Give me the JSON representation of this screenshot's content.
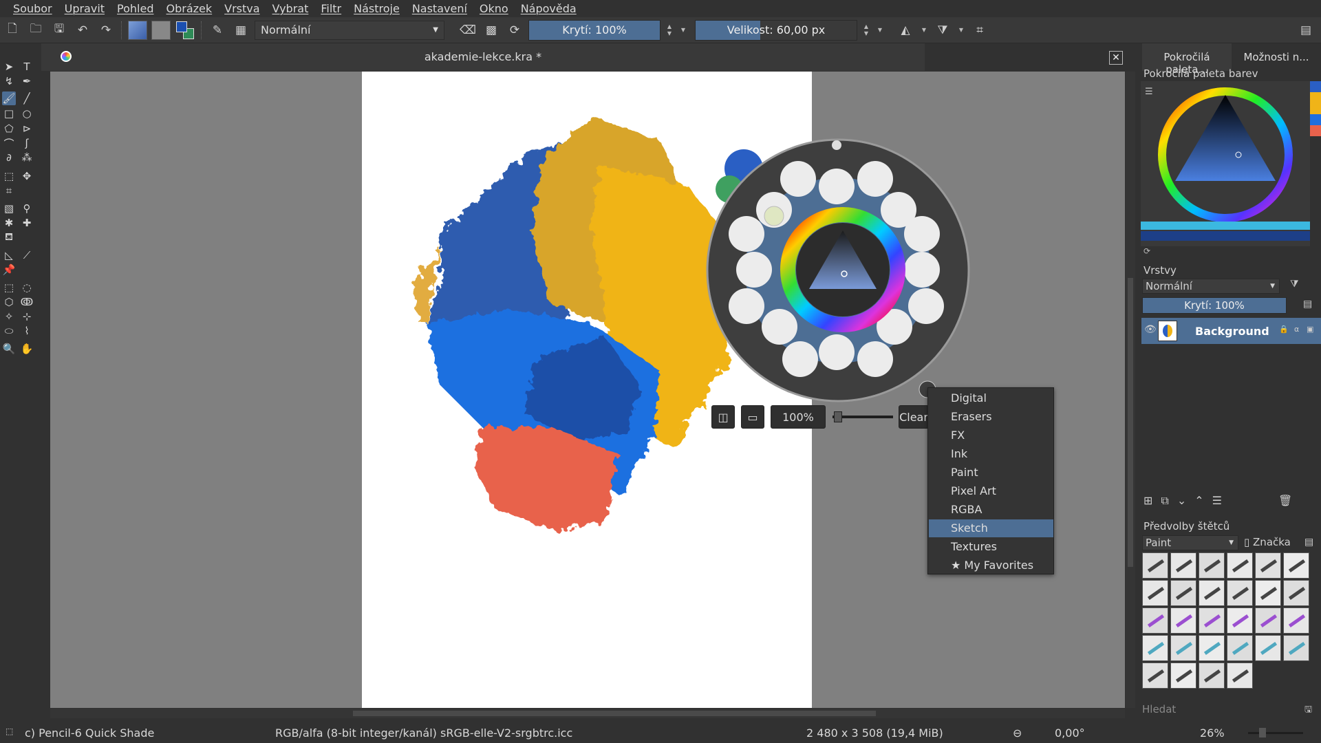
{
  "menubar": [
    "Soubor",
    "Upravit",
    "Pohled",
    "Obrázek",
    "Vrstva",
    "Vybrat",
    "Filtr",
    "Nástroje",
    "Nastavení",
    "Okno",
    "Nápověda"
  ],
  "toolbar": {
    "blend_mode": "Normální",
    "opacity_label": "Krytí: 100%",
    "opacity_value": 1.0,
    "size_label": "Velikost: 60,00 px"
  },
  "document": {
    "title": "akademie-lekce.kra *"
  },
  "right_tabs": [
    "Pokročilá paleta...",
    "Možnosti n..."
  ],
  "color_dock": {
    "title": "Pokročilá paleta barev"
  },
  "layers": {
    "title": "Vrstvy",
    "blend_mode": "Normální",
    "opacity_label": "Krytí:  100%",
    "items": [
      {
        "name": "Background"
      }
    ]
  },
  "presets": {
    "title": "Předvolby štětců",
    "tag": "Paint",
    "tag_filter": "Značka",
    "search_placeholder": "Hledat"
  },
  "popup": {
    "zoom_label": "100%",
    "clear_label": "Clear",
    "menu": [
      "Digital",
      "Erasers",
      "FX",
      "Ink",
      "Paint",
      "Pixel Art",
      "RGBA",
      "Sketch",
      "Textures",
      "★ My Favorites"
    ],
    "selected": "Sketch"
  },
  "status": {
    "brush": "c) Pencil-6 Quick Shade",
    "colorspace": "RGB/alfa (8-bit integer/kanál)  sRGB-elle-V2-srgbtrc.icc",
    "dimensions": "2 480 x 3 508 (19,4 MiB)",
    "rotation": "0,00°",
    "zoom": "26%"
  },
  "colors": {
    "accent": "#4d6e94",
    "blue": "#1f5fc9",
    "yellow": "#f0b418",
    "red": "#e8624c"
  }
}
